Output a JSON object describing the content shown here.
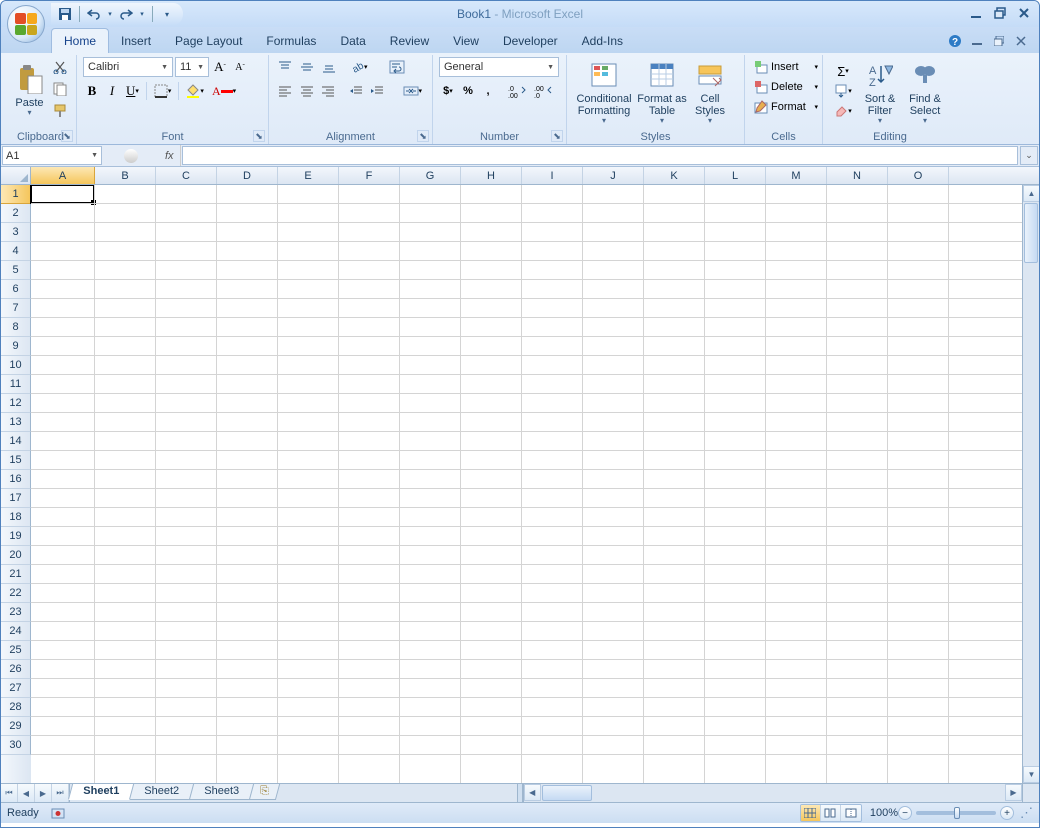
{
  "title": {
    "doc": "Book1",
    "app": "Microsoft Excel",
    "sep": " - "
  },
  "qat": {
    "save": "save-icon",
    "undo": "undo-icon",
    "redo": "redo-icon",
    "customize": "customize-qat"
  },
  "tabs": [
    "Home",
    "Insert",
    "Page Layout",
    "Formulas",
    "Data",
    "Review",
    "View",
    "Developer",
    "Add-Ins"
  ],
  "active_tab": "Home",
  "ribbon": {
    "clipboard": {
      "label": "Clipboard",
      "paste": "Paste",
      "cut": "cut-icon",
      "copy": "copy-icon",
      "painter": "format-painter-icon"
    },
    "font": {
      "label": "Font",
      "font_name": "Calibri",
      "font_size": "11",
      "grow": "A",
      "shrink": "A",
      "bold": "B",
      "italic": "I",
      "underline": "U"
    },
    "alignment": {
      "label": "Alignment",
      "wrap": "wrap-icon",
      "merge": "merge-icon"
    },
    "number": {
      "label": "Number",
      "format": "General",
      "currency": "$",
      "percent": "%",
      "comma": ",",
      "inc": ".0",
      "dec": ".00"
    },
    "styles": {
      "label": "Styles",
      "cond": "Conditional Formatting",
      "table": "Format as Table",
      "cell": "Cell Styles"
    },
    "cells": {
      "label": "Cells",
      "insert": "Insert",
      "delete": "Delete",
      "format": "Format"
    },
    "editing": {
      "label": "Editing",
      "sum": "Σ",
      "fill": "fill-icon",
      "clear": "clear-icon",
      "sort": "Sort & Filter",
      "find": "Find & Select"
    }
  },
  "namebox": "A1",
  "fx_label": "fx",
  "columns": [
    "A",
    "B",
    "C",
    "D",
    "E",
    "F",
    "G",
    "H",
    "I",
    "J",
    "K",
    "L",
    "M",
    "N",
    "O"
  ],
  "rows": [
    "1",
    "2",
    "3",
    "4",
    "5",
    "6",
    "7",
    "8",
    "9",
    "10",
    "11",
    "12",
    "13",
    "14",
    "15",
    "16",
    "17",
    "18",
    "19",
    "20",
    "21",
    "22",
    "23",
    "24",
    "25",
    "26",
    "27",
    "28",
    "29",
    "30"
  ],
  "selected_col": "A",
  "selected_row": "1",
  "sheets": [
    "Sheet1",
    "Sheet2",
    "Sheet3"
  ],
  "active_sheet": "Sheet1",
  "status": "Ready",
  "zoom": "100%"
}
